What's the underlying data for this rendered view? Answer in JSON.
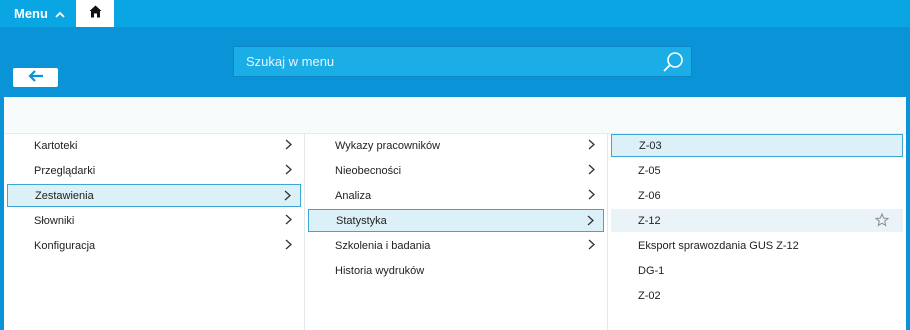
{
  "topbar": {
    "menu_label": "Menu"
  },
  "search": {
    "placeholder": "Szukaj w menu"
  },
  "columns": {
    "col1": [
      "Kartoteki",
      "Przeglądarki",
      "Zestawienia",
      "Słowniki",
      "Konfiguracja"
    ],
    "col2": [
      "Wykazy pracowników",
      "Nieobecności",
      "Analiza",
      "Statystyka",
      "Szkolenia i badania",
      "Historia wydruków"
    ],
    "col3": [
      "Z-03",
      "Z-05",
      "Z-06",
      "Z-12",
      "Eksport sprawozdania GUS Z-12",
      "DG-1",
      "Z-02"
    ]
  },
  "colors": {
    "brand": "#0aa6e3",
    "panel": "#0a93d6",
    "selected_bg": "#dcf0f8",
    "selected_border": "#3aa7d8"
  }
}
